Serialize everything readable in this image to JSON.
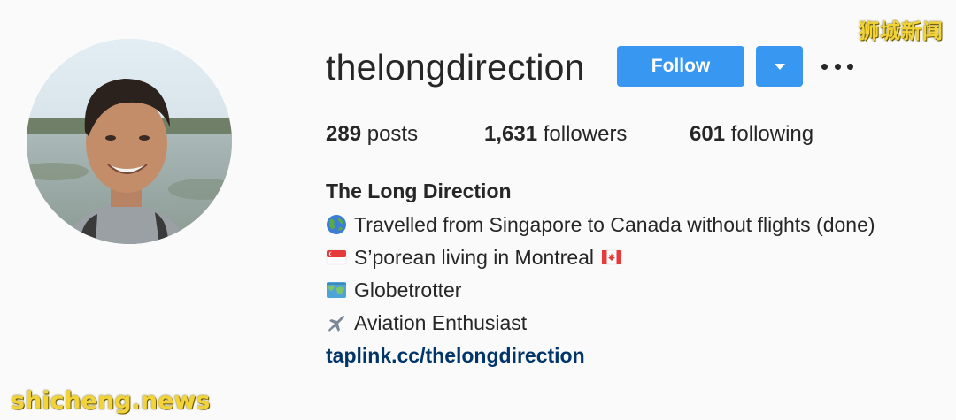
{
  "profile": {
    "username": "thelongdirection",
    "follow_label": "Follow",
    "stats": {
      "posts_count": "289",
      "posts_label": "posts",
      "followers_count": "1,631",
      "followers_label": "followers",
      "following_count": "601",
      "following_label": "following"
    },
    "full_name": "The Long Direction",
    "bio": [
      {
        "icon": "globe-icon",
        "text": "Travelled from Singapore to Canada without flights (done)"
      },
      {
        "icon": "singapore-flag-icon",
        "text": "S’porean living in Montreal",
        "trailing_icon": "canada-flag-icon"
      },
      {
        "icon": "map-icon",
        "text": "Globetrotter"
      },
      {
        "icon": "airplane-icon",
        "text": "Aviation Enthusiast"
      }
    ],
    "link": "taplink.cc/thelongdirection"
  },
  "watermarks": {
    "top_right": "狮城新闻",
    "bottom_left": "shicheng.news"
  },
  "colors": {
    "background": "#fafafa",
    "follow_button": "#3897f0",
    "link": "#003569",
    "watermark": "#f2d43a"
  }
}
